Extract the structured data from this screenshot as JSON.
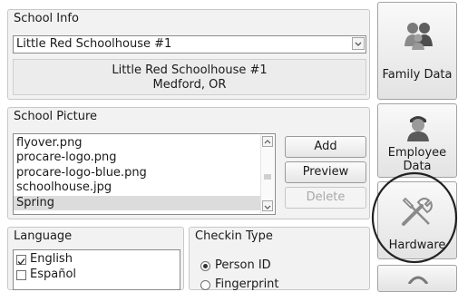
{
  "school_info": {
    "title": "School Info",
    "selected_school": "Little Red Schoolhouse #1",
    "display_name": "Little Red Schoolhouse #1",
    "display_location": "Medford, OR"
  },
  "school_picture": {
    "title": "School Picture",
    "files": [
      "flyover.png",
      "procare-logo.png",
      "procare-logo-blue.png",
      "schoolhouse.jpg",
      "Spring"
    ],
    "selected_index": 4,
    "buttons": {
      "add": "Add",
      "preview": "Preview",
      "delete": "Delete"
    }
  },
  "language": {
    "title": "Language",
    "options": [
      {
        "label": "English",
        "checked": true
      },
      {
        "label": "Español",
        "checked": false
      }
    ]
  },
  "checkin_type": {
    "title": "Checkin Type",
    "options": [
      {
        "label": "Person ID",
        "selected": true
      },
      {
        "label": "Fingerprint",
        "selected": false
      }
    ]
  },
  "side_nav": {
    "family_data": "Family Data",
    "employee_data_line1": "Employee",
    "employee_data_line2": "Data",
    "hardware": "Hardware"
  },
  "colors": {
    "highlight_circle": "#222222",
    "selected_row": "#dcdcdc"
  },
  "icons": [
    "family-people-icon",
    "employee-person-icon",
    "hardware-tools-icon",
    "partial-icon"
  ]
}
